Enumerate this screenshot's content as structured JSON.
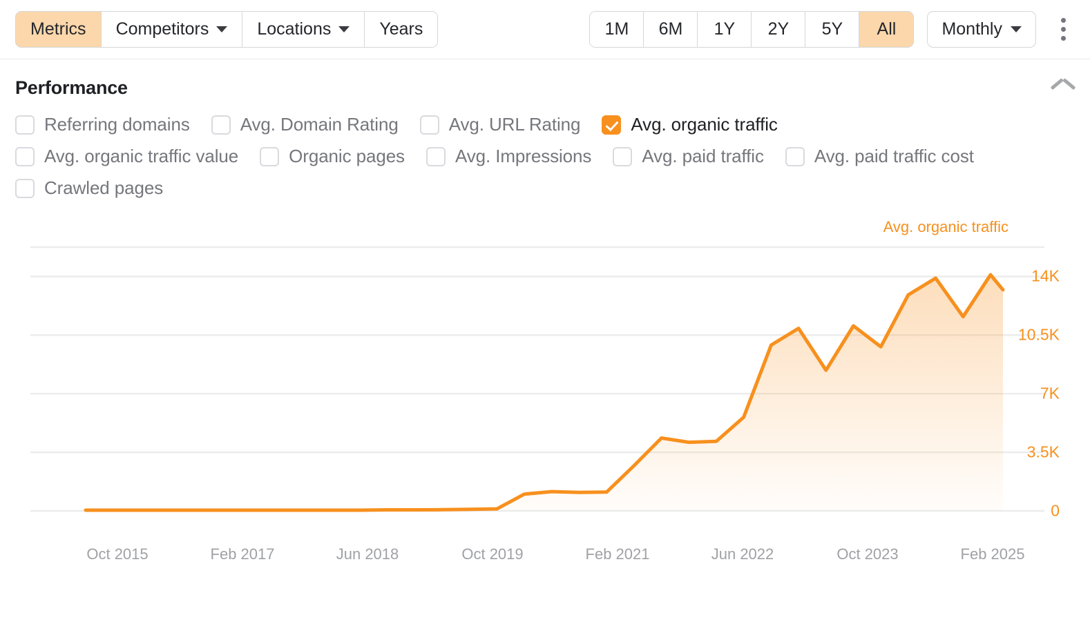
{
  "toolbar": {
    "tabs": [
      {
        "label": "Metrics",
        "icon": null,
        "active": true
      },
      {
        "label": "Competitors",
        "icon": "chevron-down-icon",
        "active": false
      },
      {
        "label": "Locations",
        "icon": "chevron-down-icon",
        "active": false
      },
      {
        "label": "Years",
        "icon": null,
        "active": false
      }
    ],
    "ranges": [
      {
        "label": "1M",
        "active": false
      },
      {
        "label": "6M",
        "active": false
      },
      {
        "label": "1Y",
        "active": false
      },
      {
        "label": "2Y",
        "active": false
      },
      {
        "label": "5Y",
        "active": false
      },
      {
        "label": "All",
        "active": true
      }
    ],
    "period": {
      "label": "Monthly",
      "icon": "chevron-down-icon"
    },
    "more_menu_icon": "kebab-menu-icon"
  },
  "panel": {
    "title": "Performance",
    "collapse_icon": "chevron-up-icon",
    "metric_rows": [
      [
        {
          "label": "Referring domains",
          "checked": false
        },
        {
          "label": "Avg. Domain Rating",
          "checked": false
        },
        {
          "label": "Avg. URL Rating",
          "checked": false
        },
        {
          "label": "Avg. organic traffic",
          "checked": true
        }
      ],
      [
        {
          "label": "Avg. organic traffic value",
          "checked": false
        },
        {
          "label": "Organic pages",
          "checked": false
        },
        {
          "label": "Avg. Impressions",
          "checked": false
        },
        {
          "label": "Avg. paid traffic",
          "checked": false
        },
        {
          "label": "Avg. paid traffic cost",
          "checked": false
        }
      ],
      [
        {
          "label": "Crawled pages",
          "checked": false
        }
      ]
    ]
  },
  "colors": {
    "accent": "#f7901e",
    "accent_soft": "#fbd7ab",
    "grid": "#ececec",
    "muted_text": "#76777c"
  },
  "chart_data": {
    "type": "area",
    "title": "",
    "series_name": "Avg. organic traffic",
    "xlabel": "",
    "ylabel": "",
    "ylim": [
      0,
      15750
    ],
    "ytick_labels": [
      "14K",
      "10.5K",
      "7K",
      "3.5K",
      "0"
    ],
    "ytick_values": [
      14000,
      10500,
      7000,
      3500,
      0
    ],
    "xtick_labels": [
      "Oct 2015",
      "Feb 2017",
      "Jun 2018",
      "Oct 2019",
      "Feb 2021",
      "Jun 2022",
      "Oct 2023",
      "Feb 2025"
    ],
    "grid": true,
    "legend_position": "top-right",
    "x": [
      "Oct 2015",
      "Apr 2016",
      "Oct 2016",
      "Feb 2017",
      "Aug 2017",
      "Feb 2018",
      "Jun 2018",
      "Dec 2018",
      "Jun 2019",
      "Oct 2019",
      "Apr 2020",
      "Aug 2020",
      "Feb 2021",
      "Aug 2021",
      "Dec 2021",
      "Mar 2022",
      "May 2022",
      "Jun 2022",
      "Aug 2022",
      "Oct 2022",
      "Dec 2022",
      "Feb 2023",
      "Apr 2023",
      "Jun 2023",
      "Aug 2023",
      "Oct 2023",
      "Dec 2023",
      "Feb 2024",
      "Apr 2024",
      "Jun 2024",
      "Aug 2024",
      "Oct 2024",
      "Dec 2024",
      "Feb 2025"
    ],
    "values": [
      40,
      40,
      40,
      40,
      40,
      40,
      40,
      40,
      40,
      40,
      40,
      60,
      60,
      70,
      90,
      120,
      1000,
      1150,
      1100,
      1120,
      2700,
      4350,
      4100,
      4150,
      5600,
      9900,
      10900,
      8400,
      11050,
      9800,
      12900,
      13900,
      11600,
      14100
    ],
    "final_value": 13200
  }
}
